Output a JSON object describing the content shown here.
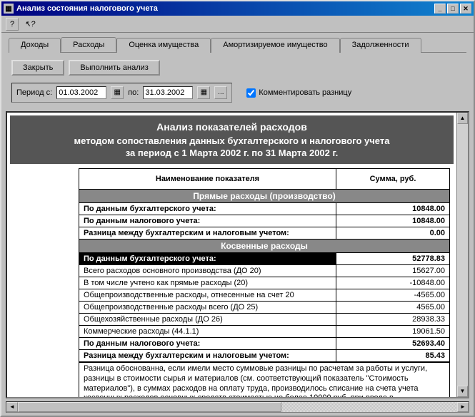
{
  "window": {
    "title": "Анализ состояния налогового учета"
  },
  "tabs": {
    "0": "Доходы",
    "1": "Расходы",
    "2": "Оценка имущества",
    "3": "Амортизируемое имущество",
    "4": "Задолженности"
  },
  "buttons": {
    "close": "Закрыть",
    "run": "Выполнить анализ"
  },
  "period": {
    "from_label": "Период с:",
    "from_value": "01.03.2002",
    "to_label": "по:",
    "to_value": "31.03.2002",
    "ellipsis": "..."
  },
  "checkbox": {
    "comment_diff": "Комментировать разницу",
    "checked": true
  },
  "report": {
    "h1": "Анализ показателей расходов",
    "h2": "методом сопоставления данных бухгалтерского и налогового учета",
    "h3": "за  период с 1 Марта 2002 г. по 31 Марта 2002 г.",
    "col_name": "Наименование показателя",
    "col_sum": "Сумма, руб.",
    "section1": "Прямые расходы (производство)",
    "row_acc1": "По данным бухгалтерского учета:",
    "val_acc1": "10848.00",
    "row_tax1": "По данным налогового учета:",
    "val_tax1": "10848.00",
    "row_diff1": "Разница между бухгалтерским и налоговым учетом:",
    "val_diff1": "0.00",
    "section2": "Косвенные расходы",
    "row_acc2": "По данным бухгалтерского учета:",
    "val_acc2": "52778.83",
    "r1": "Всего расходов основного производства (ДО 20)",
    "v1": "15627.00",
    "r2": "В том числе учтено как прямые расходы (20)",
    "v2": "-10848.00",
    "r3": "Общепроизводственные расходы, отнесенные на счет 20",
    "v3": "-4565.00",
    "r4": "Общепроизводственные расходы всего (ДО 25)",
    "v4": "4565.00",
    "r5": "Общехозяйственные расходы (ДО 26)",
    "v5": "28938.33",
    "r6": "Коммерческие расходы (44.1.1)",
    "v6": "19061.50",
    "row_tax2": "По данным налогового учета:",
    "val_tax2": "52693.40",
    "row_diff2": "Разница между бухгалтерским и налоговым учетом:",
    "val_diff2": "85.43",
    "note": "Разница обоснованна, если имели место суммовые разницы по расчетам за работы и услуги, разницы в стоимости сырья и материалов (см. соответствующий показатель \"Стоимость материалов\"), в суммах расходов на оплату труда, производилось списание на счета учета косвенных расходов основных средств стоимостью не более 10000 руб. при вводе в эксплуатацию"
  }
}
